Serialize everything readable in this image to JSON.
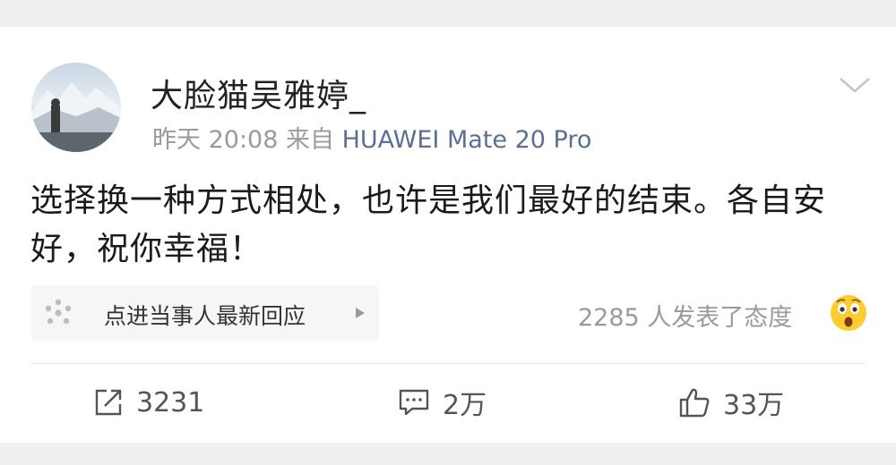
{
  "post": {
    "username": "大脸猫吴雅婷_",
    "time": "昨天 20:08",
    "source_prefix": "来自",
    "device": "HUAWEI Mate 20 Pro",
    "content": "选择换一种方式相处，也许是我们最好的结束。各自安好，祝你幸福！"
  },
  "reply_prompt": {
    "label": "点进当事人最新回应",
    "icon": "sparkle-dots-icon"
  },
  "attitude": {
    "text": "2285 人发表了态度",
    "emoji": "shocked-face-emoji"
  },
  "actions": {
    "repost": {
      "count": "3231",
      "icon": "repost-icon"
    },
    "comment": {
      "count": "2万",
      "icon": "comment-icon"
    },
    "like": {
      "count": "33万",
      "icon": "thumbs-up-icon"
    }
  },
  "colors": {
    "device_link": "#5b6f91",
    "meta_gray": "#9a9a9a",
    "background": "#efefef"
  }
}
